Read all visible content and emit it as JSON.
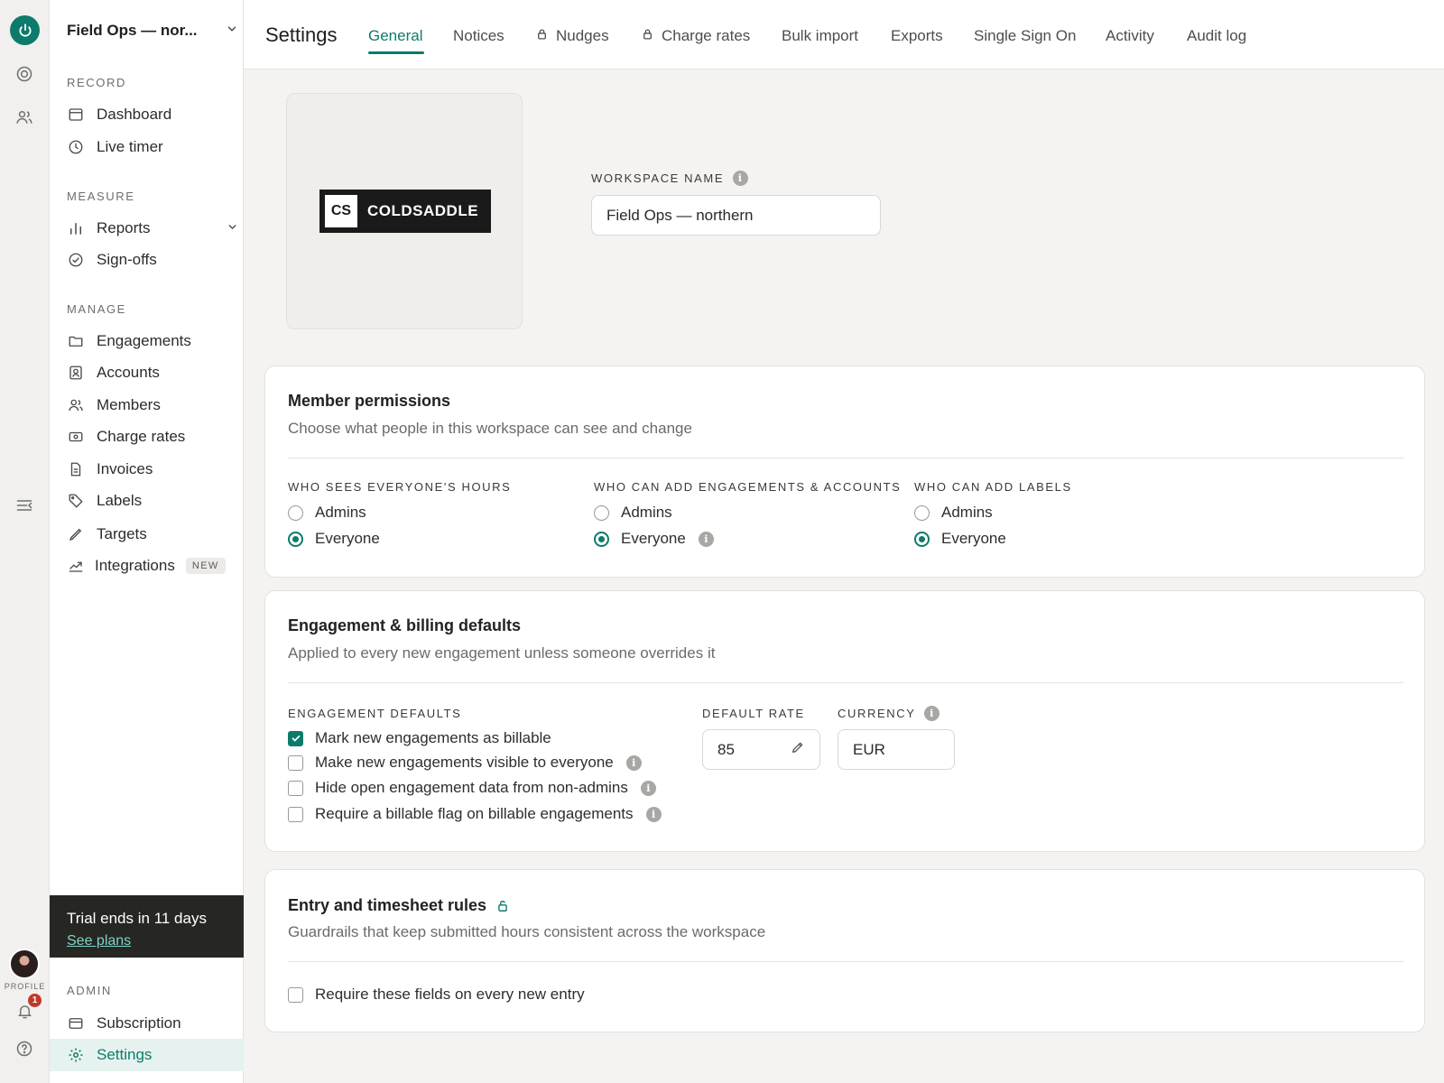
{
  "rail": {
    "profile_label": "PROFILE",
    "notification_count": "1"
  },
  "sidebar": {
    "workspace_name": "Field Ops — nor...",
    "sections": {
      "record": "RECORD",
      "measure": "MEASURE",
      "manage": "MANAGE",
      "admin": "ADMIN"
    },
    "items": {
      "dashboard": "Dashboard",
      "live_timer": "Live timer",
      "reports": "Reports",
      "sign_offs": "Sign-offs",
      "engagements": "Engagements",
      "accounts": "Accounts",
      "members": "Members",
      "charge_rates": "Charge rates",
      "invoices": "Invoices",
      "labels": "Labels",
      "targets": "Targets",
      "integrations": "Integrations",
      "integrations_badge": "NEW",
      "subscription": "Subscription",
      "settings": "Settings"
    },
    "trial": {
      "text": "Trial ends in 11 days",
      "link": "See plans"
    }
  },
  "header": {
    "title": "Settings",
    "tabs": [
      "General",
      "Notices",
      "Nudges",
      "Charge rates",
      "Bulk import",
      "Exports",
      "Single Sign On",
      "Activity",
      "Audit log"
    ],
    "active_tab": "General"
  },
  "workspace": {
    "logo_initials": "CS",
    "logo_word": "COLDSADDLE",
    "name_label": "WORKSPACE NAME",
    "name_value": "Field Ops — northern"
  },
  "member_permissions": {
    "title": "Member permissions",
    "subtitle": "Choose what people in this workspace can see and change",
    "groups": [
      {
        "label": "WHO SEES EVERYONE'S HOURS",
        "options": [
          "Admins",
          "Everyone"
        ],
        "selected": "Everyone"
      },
      {
        "label": "WHO CAN ADD ENGAGEMENTS & ACCOUNTS",
        "options": [
          "Admins",
          "Everyone"
        ],
        "selected": "Everyone"
      },
      {
        "label": "WHO CAN ADD LABELS",
        "options": [
          "Admins",
          "Everyone"
        ],
        "selected": "Everyone"
      }
    ]
  },
  "billing_defaults": {
    "title": "Engagement & billing defaults",
    "subtitle": "Applied to every new engagement unless someone overrides it",
    "defaults_label": "ENGAGEMENT DEFAULTS",
    "checks": [
      {
        "label": "Mark new engagements as billable",
        "checked": true
      },
      {
        "label": "Make new engagements visible to everyone",
        "checked": false
      },
      {
        "label": "Hide open engagement data from non-admins",
        "checked": false
      },
      {
        "label": "Require a billable flag on billable engagements",
        "checked": false
      }
    ],
    "rate_label": "DEFAULT RATE",
    "rate_value": "85",
    "currency_label": "CURRENCY",
    "currency_value": "EUR"
  },
  "entry_rules": {
    "title": "Entry and timesheet rules",
    "subtitle": "Guardrails that keep submitted hours consistent across the workspace",
    "check_label": "Require these fields on every new entry",
    "checked": false
  },
  "colors": {
    "accent": "#0d7b6b",
    "trial_bg": "#262623",
    "badge": "#c0392b"
  }
}
